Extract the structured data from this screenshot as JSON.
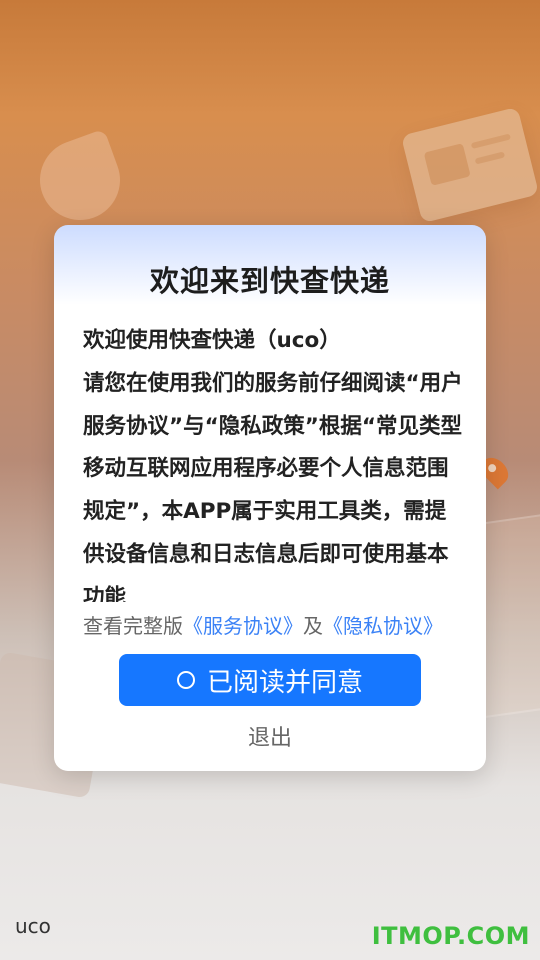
{
  "dialog": {
    "title": "欢迎来到快查快递",
    "body": "欢迎使用快查快递（uco）\n请您在使用我们的服务前仔细阅读“用户服务协议”与“隐私政策”根据“常见类型移动互联网应用程序必要个人信息范围规定”，本APP属于实用工具类，需提供设备信息和日志信息后即可使用基本功能",
    "links": {
      "prefix": "查看完整版",
      "service_agreement": "《服务协议》",
      "conjunction": "及",
      "privacy_agreement": "《隐私协议》"
    },
    "agree_label": "已阅读并同意",
    "exit_label": "退出"
  },
  "footer": {
    "text": "uco"
  },
  "watermark": {
    "text": "ITMOP.COM"
  },
  "colors": {
    "primary_button": "#1677ff",
    "link": "#3b82f6",
    "watermark": "#3fbf3f"
  },
  "icons": {
    "agree_radio": "radio-unchecked-icon"
  }
}
